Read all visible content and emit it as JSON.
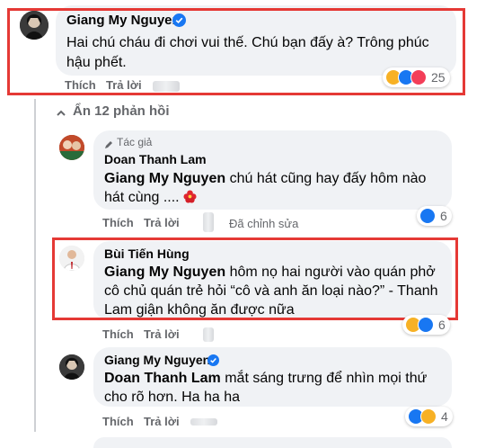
{
  "colors": {
    "bubble": "#f0f2f5",
    "like_blue": "#1877f2",
    "highlight_red": "#e53935",
    "muted": "#65676b"
  },
  "comment1": {
    "author": "Giang My Nguyen",
    "line1": "Hai chú cháu đi chơi vui thế. Chú bạn đấy à? Trông phúc",
    "line2": "hậu phết.",
    "like": "Thích",
    "reply": "Trả lời",
    "reaction_count": "25",
    "reaction_icons": [
      "haha-icon",
      "like-icon",
      "love-icon"
    ]
  },
  "hide_replies": {
    "label": "Ẩn 12 phản hồi",
    "icon": "arrow-up-icon"
  },
  "reply1": {
    "badge": "Tác giả",
    "badge_icon": "pen-icon",
    "author": "Doan Thanh Lam",
    "mention": "Giang My Nguyen",
    "line1_rest": " chú hát cũng hay đấy hôm nào",
    "line2": "hát cùng ....",
    "flower_icon": "hibiscus-icon",
    "like": "Thích",
    "reply": "Trả lời",
    "edited": "Đã chỉnh sửa",
    "reaction_count": "6",
    "reaction_icons": [
      "like-icon"
    ]
  },
  "reply2": {
    "author": "Bùi Tiến Hùng",
    "mention": "Giang My Nguyen",
    "line1_rest": " hôm nọ hai người vào quán phở",
    "line2": "cô chủ quán trẻ hỏi “cô và anh ăn loại nào?” - Thanh",
    "line3": "Lam giận không ăn được nữa",
    "like": "Thích",
    "reply": "Trả lời",
    "reaction_count": "6",
    "reaction_icons": [
      "haha-icon",
      "like-icon"
    ]
  },
  "reply3": {
    "author": "Giang My Nguyen",
    "mention": "Doan Thanh Lam",
    "line1_rest": " mắt sáng trưng để nhìn mọi thứ",
    "line2": "cho rõ hơn. Ha ha ha",
    "like": "Thích",
    "reply": "Trả lời",
    "reaction_count": "4",
    "reaction_icons": [
      "like-icon",
      "haha-icon"
    ]
  }
}
